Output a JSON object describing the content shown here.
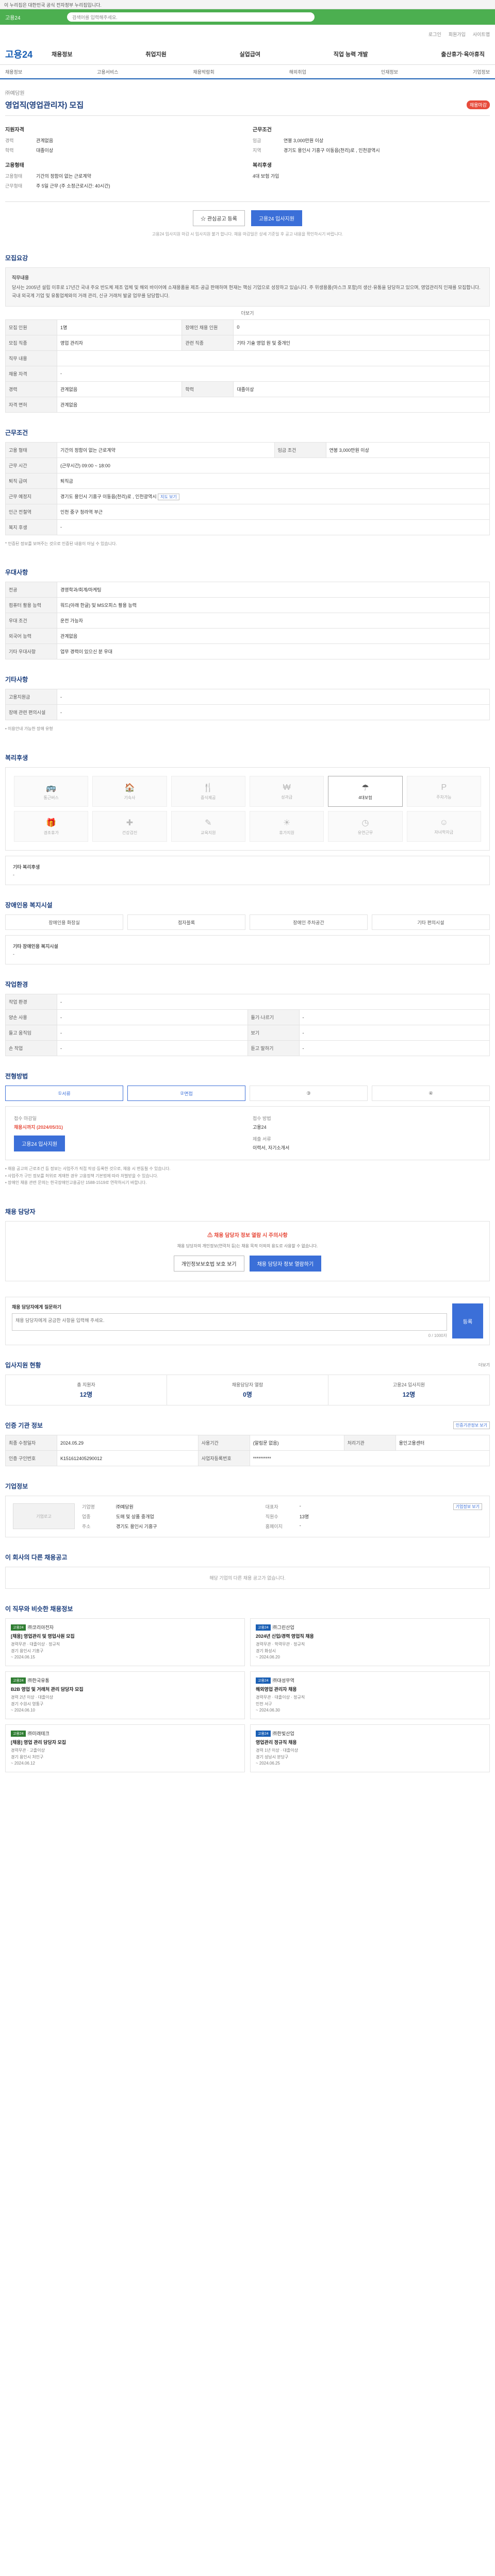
{
  "topbar": {
    "notice": "이 누리집은 대한민국 공식 전자정부 누리집입니다."
  },
  "search": {
    "logo": "고용24",
    "placeholder": "검색어를 입력해주세요."
  },
  "util": {
    "items": [
      "로그인",
      "회원가입",
      "사이트맵"
    ]
  },
  "gnb": {
    "brand": "고용24",
    "menu": [
      "채용정보",
      "취업지원",
      "실업급여",
      "직업 능력 개발",
      "출산휴가·육아휴직"
    ]
  },
  "subnav": {
    "items": [
      "채용정보",
      "고용서비스",
      "채용박람회",
      "해외취업",
      "인재정보",
      "기업정보"
    ]
  },
  "job": {
    "company": "㈜예담원",
    "title": "영업직(영업관리자) 모집",
    "badge": "채용마감",
    "summary_left_title": "지원자격",
    "summary_right_title": "근무조건",
    "left": [
      {
        "k": "경력",
        "v": "관계없음"
      },
      {
        "k": "학력",
        "v": "대졸이상"
      }
    ],
    "right": [
      {
        "k": "임금",
        "v": "연봉 3,000만원 이상"
      },
      {
        "k": "지역",
        "v": "경기도 용인시 기흥구 이동읍(천리)로 , 인천광역시"
      }
    ],
    "left2_title": "고용형태",
    "left2": [
      {
        "k": "고용형태",
        "v": "기간의 정함이 없는 근로계약"
      },
      {
        "k": "근무형태",
        "v": "주 5일 근무 (주 소정근로시간: 40시간)"
      }
    ],
    "right2_title": "복리후생",
    "right2": [
      {
        "k": "",
        "v": "4대 보험 가입"
      }
    ],
    "btn_save": "관심공고 등록",
    "btn_apply": "고용24 입사지원",
    "note": "고용24 입사지원 마감 시 입사지원 불가 합니다. 채용 마감일은 상세 기준일 후 공고 내용을 확인하시기 바랍니다."
  },
  "detail": {
    "title": "모집요강",
    "content_title": "직무내용",
    "content": "당사는 2005년 설립 이후로 17년간 국내 주요 반도체 제조 업체 및 해외 바이어에 소재용품을 제조·공급 판매하며 현재는 핵심 기업으로 성장하고 있습니다. 주 위생용품(마스크 포함)의 생산·유통을 담당하고 있으며, 영업관리직 인재를 모집합니다. 국내 외국계 기업 및 유통업체와의 거래 관리, 신규 거래처 발굴 업무를 담당합니다.",
    "more": "더보기"
  },
  "recruit": {
    "rows": [
      {
        "k": "모집 인원",
        "v": "1명",
        "k2": "장애인 채용 인원",
        "v2": "0"
      },
      {
        "k": "모집 직종",
        "v": "영업 관리자",
        "k2": "관련 직종",
        "v2": "기타 기술 영업 원 및 중개인"
      },
      {
        "k": "직무 내용",
        "v": ""
      },
      {
        "k": "채용 자격",
        "v": "-"
      },
      {
        "k": "경력",
        "v": "관계없음",
        "k2": "학력",
        "v2": "대졸이상"
      },
      {
        "k": "자격 면허",
        "v": "관계없음"
      }
    ]
  },
  "conditions": {
    "title": "근무조건",
    "rows": [
      {
        "k": "고용 형태",
        "v": "기간의 정함이 없는 근로계약",
        "k2": "임금 조건",
        "v2": "연봉 3,000만원 이상"
      },
      {
        "k": "근무 시간",
        "v": "(근무시간) 09:00 ~ 18:00"
      },
      {
        "k": "퇴직 급여",
        "v": "퇴직금"
      },
      {
        "k": "근무 예정지",
        "v": "경기도 용인시 기흥구 이동읍(천리)로 , 인천광역시"
      },
      {
        "k": "인근 전철역",
        "v": "인천 중구 청라역 부근"
      },
      {
        "k": "복지 후생",
        "v": "-"
      }
    ],
    "btn_map": "지도 보기",
    "note": "* 인증된 정보를 보여주는 것으로 인증된 내용이 아닐 수 있습니다."
  },
  "qualif": {
    "title": "우대사항",
    "rows": [
      {
        "k": "전공",
        "v": "경영학과/회계/마케팅"
      },
      {
        "k": "컴퓨터 활용 능력",
        "v": "워드(아래 한글) 및 MS오피스 활용 능력"
      },
      {
        "k": "우대 조건",
        "v": "운전 가능자"
      },
      {
        "k": "외국어 능력",
        "v": "관계없음"
      },
      {
        "k": "기타 우대사항",
        "v": "업무 경력이 있으신 분 우대"
      }
    ]
  },
  "other": {
    "title": "기타사항",
    "rows": [
      {
        "k": "고용지원금",
        "v": "-"
      },
      {
        "k": "장애 관련 편의시설",
        "v": "-"
      }
    ],
    "bullet": "이용안내 가능한 장애 유형"
  },
  "benefits": {
    "title": "복리후생",
    "items": [
      {
        "icon": "bus-icon",
        "glyph": "🚌",
        "label": "통근버스",
        "on": false
      },
      {
        "icon": "dorm-icon",
        "glyph": "🏠",
        "label": "기숙사",
        "on": false
      },
      {
        "icon": "meal-icon",
        "glyph": "🍴",
        "label": "중식제공",
        "on": false
      },
      {
        "icon": "bonus-icon",
        "glyph": "₩",
        "label": "성과급",
        "on": false
      },
      {
        "icon": "insurance-icon",
        "glyph": "☂",
        "label": "4대보험",
        "on": true
      },
      {
        "icon": "parking-icon",
        "glyph": "P",
        "label": "주차가능",
        "on": false
      },
      {
        "icon": "gift-icon",
        "glyph": "🎁",
        "label": "경조휴가",
        "on": false
      },
      {
        "icon": "health-icon",
        "glyph": "✚",
        "label": "건강검진",
        "on": false
      },
      {
        "icon": "training-icon",
        "glyph": "✎",
        "label": "교육지원",
        "on": false
      },
      {
        "icon": "vacation-icon",
        "glyph": "☀",
        "label": "휴가지원",
        "on": false
      },
      {
        "icon": "clock-icon",
        "glyph": "◷",
        "label": "유연근무",
        "on": false
      },
      {
        "icon": "child-icon",
        "glyph": "☺",
        "label": "자녀학자금",
        "on": false
      }
    ],
    "other_title": "기타 복리후생",
    "other_value": "-"
  },
  "disabled": {
    "title": "장애인용 복지시설",
    "steps": [
      "장애인용 화장실",
      "점자블록",
      "장애인 주차공간",
      "기타 편의시설"
    ],
    "other_title": "기타 장애인용 복지시설",
    "other_value": "-"
  },
  "env": {
    "title": "작업환경",
    "rows": [
      {
        "k": "작업 환경",
        "v": "-"
      },
      {
        "k": "양손 사용",
        "v": "-",
        "k2": "들기·나르기",
        "v2": "-"
      },
      {
        "k": "들고 움직임",
        "v": "-",
        "k2": "보기",
        "v2": "-"
      },
      {
        "k": "손 작업",
        "v": "-",
        "k2": "듣고 말하기",
        "v2": "-"
      }
    ]
  },
  "process": {
    "title": "전형방법",
    "steps": [
      "서류",
      "면접",
      "",
      ""
    ],
    "how_title1": "접수 마감일",
    "deadline": "채용시까지 (2024/05/31)",
    "how_title2": "접수 방법",
    "method": "고용24",
    "how_title3": "제출 서류",
    "docs": "이력서, 자기소개서",
    "apply": "고용24 입사지원"
  },
  "bullets": [
    "• 채용 공고의 근로조건 등 정보는 사업주가 직접 작성·등록한 것으로, 채용 시 변동될 수 있습니다.",
    "• 사업주가 구인 정보를 허위로 게재한 경우 고용정책 기본법에 따라 처벌받을 수 있습니다.",
    "• 장애인 채용 관련 문의는 한국장애인고용공단 1588-1519로 연락하시기 바랍니다."
  ],
  "contact": {
    "title": "채용 담당자",
    "header": "채용 담당자 정보 열람 시 주의사항",
    "text": "채용 담당자의 개인정보(연락처 등)는 채용 목적 이외의 용도로 사용할 수 없습니다.",
    "btn1": "개인정보보호법 보호 보기",
    "btn2": "채용 담당자 정보 열람하기"
  },
  "inquiry": {
    "title": "채용 담당자에게 질문하기",
    "placeholder": "채용 담당자에게 궁금한 사항을 입력해 주세요.",
    "count": "0 / 1000자",
    "send": "등록"
  },
  "stats": {
    "title": "입사지원 현황",
    "link": "더보기",
    "items": [
      {
        "label": "총 지원자",
        "num": "12명"
      },
      {
        "label": "채용담당자 열람",
        "num": "0명"
      },
      {
        "label": "고용24 입사지원",
        "num": "12명"
      }
    ]
  },
  "source": {
    "title": "인증 기관 정보",
    "btn": "인증기관정보 보기",
    "rows": [
      {
        "k": "최종 수정일자",
        "v": "2024.05.29",
        "k2": "사용기간",
        "v2": "(알림문 없음)",
        "k3": "처리기관",
        "v3": "용인고용센터"
      },
      {
        "k": "인증 구인번호",
        "v": "K151612405290012",
        "k2": "사업자등록번호",
        "v2": "**********"
      }
    ]
  },
  "company": {
    "title": "기업정보",
    "logo": "기업로고",
    "name": "㈜예담원",
    "btn": "기업정보 보기",
    "info": [
      {
        "k": "기업명",
        "v": "㈜예담원"
      },
      {
        "k": "대표자",
        "v": "-"
      },
      {
        "k": "업종",
        "v": "도매 및 상품 중개업"
      },
      {
        "k": "직원수",
        "v": "13명"
      },
      {
        "k": "주소",
        "v": "경기도 용인시 기흥구"
      },
      {
        "k": "홈페이지",
        "v": "-"
      }
    ]
  },
  "similar": {
    "title": "이 회사의 다른 채용공고",
    "empty": "해당 기업의 다른 채용 공고가 없습니다."
  },
  "recommend": {
    "title": "이 직무와 비슷한 채용정보",
    "cards": [
      {
        "tag": "고용24",
        "company": "㈜코리아전자",
        "title": "[채용] 영업관리 및 영업사원 모집",
        "meta1": "경력무관 · 대졸이상 · 정규직",
        "meta2": "경기 용인시 기흥구",
        "date": "~ 2024.06.15"
      },
      {
        "tag": "고용24",
        "company": "㈜그린산업",
        "title": "2024년 신입/경력 영업직 채용",
        "meta1": "경력무관 · 학력무관 · 정규직",
        "meta2": "경기 화성시",
        "date": "~ 2024.06.20"
      },
      {
        "tag": "고용24",
        "company": "㈜한국유통",
        "title": "B2B 영업 및 거래처 관리 담당자 모집",
        "meta1": "경력 2년 이상 · 대졸이상",
        "meta2": "경기 수원시 영통구",
        "date": "~ 2024.06.10"
      },
      {
        "tag": "고용24",
        "company": "㈜대성무역",
        "title": "해외영업 관리자 채용",
        "meta1": "경력무관 · 대졸이상 · 정규직",
        "meta2": "인천 서구",
        "date": "~ 2024.06.30"
      },
      {
        "tag": "고용24",
        "company": "㈜미래테크",
        "title": "[채용] 영업 관리 담당자 모집",
        "meta1": "경력무관 · 고졸이상",
        "meta2": "경기 용인시 처인구",
        "date": "~ 2024.06.12"
      },
      {
        "tag": "고용24",
        "company": "㈜한빛산업",
        "title": "영업관리 정규직 채용",
        "meta1": "경력 1년 이상 · 대졸이상",
        "meta2": "경기 성남시 분당구",
        "date": "~ 2024.06.25"
      }
    ]
  }
}
